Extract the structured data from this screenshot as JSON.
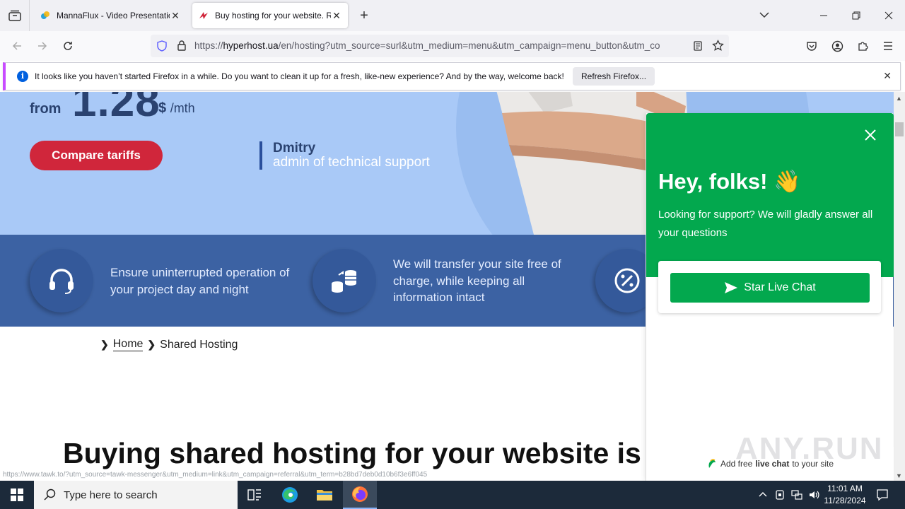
{
  "browser": {
    "tabs": [
      {
        "title": "MannaFlux - Video Presentation",
        "active": false
      },
      {
        "title": "Buy hosting for your website. R",
        "active": true
      }
    ],
    "url": {
      "prefix": "https://",
      "domain": "hyperhost.ua",
      "path": "/en/hosting?utm_source=surl&utm_medium=menu&utm_campaign=menu_button&utm_co"
    },
    "notification": {
      "message": "It looks like you haven’t started Firefox in a while. Do you want to clean it up for a fresh, like-new experience? And by the way, welcome back!",
      "button": "Refresh Firefox..."
    }
  },
  "hero": {
    "price_from": "from",
    "price_value": "1.28",
    "price_currency": "$",
    "price_period": "/mth",
    "cta": "Compare tariffs",
    "quote_name": "Dmitry",
    "quote_role": "admin of technical support"
  },
  "features": [
    {
      "icon": "headset-icon",
      "text": "Ensure uninterrupted operation of your project day and night"
    },
    {
      "icon": "database-transfer-icon",
      "text": "We will transfer your site free of charge, while keeping all information intact"
    },
    {
      "icon": "percent-icon",
      "text": ""
    }
  ],
  "breadcrumb": {
    "home": "Home",
    "current": "Shared Hosting"
  },
  "heading": "Buying shared hosting for your website is a",
  "status_url": "https://www.tawk.to/?utm_source=tawk-messenger&utm_medium=link&utm_campaign=referral&utm_term=b28bd7deb0d10b6f3e6ff045",
  "chat": {
    "title": "Hey, folks! 👋",
    "subtitle": "Looking for support? We will gladly answer all your questions",
    "button": "Star Live Chat",
    "footer_pre": "Add free",
    "footer_bold": "live chat",
    "footer_post": "to your site",
    "accent": "#03a84e"
  },
  "watermark": "ANY.RUN",
  "taskbar": {
    "search_placeholder": "Type here to search",
    "time": "11:01 AM",
    "date": "11/28/2024"
  }
}
